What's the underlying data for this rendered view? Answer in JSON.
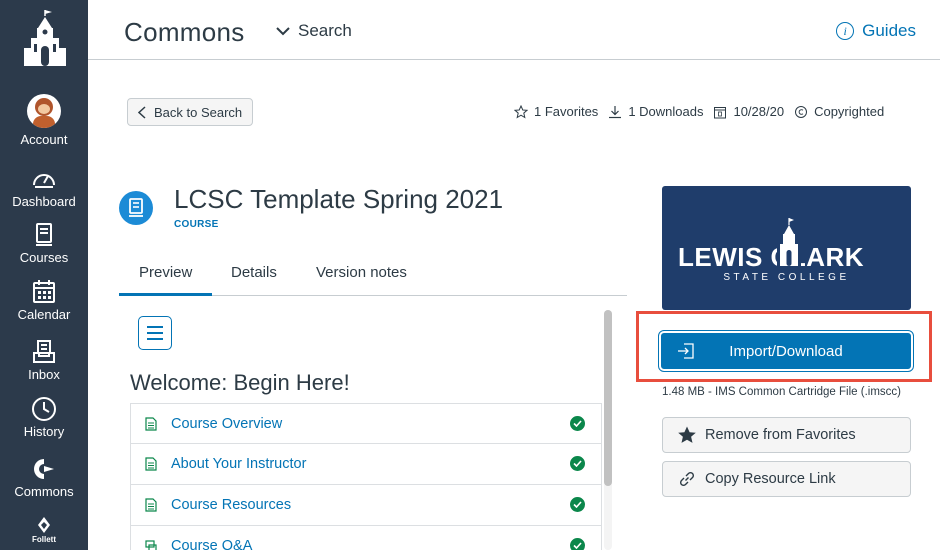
{
  "nav": {
    "account": "Account",
    "dashboard": "Dashboard",
    "courses": "Courses",
    "calendar": "Calendar",
    "inbox": "Inbox",
    "history": "History",
    "commons": "Commons",
    "follett": "Follett"
  },
  "header": {
    "title": "Commons",
    "search_label": "Search",
    "guides_label": "Guides"
  },
  "toolbar": {
    "back_label": "Back to Search",
    "favorites": "1 Favorites",
    "downloads": "1 Downloads",
    "date": "10/28/20",
    "license": "Copyrighted"
  },
  "course": {
    "title": "LCSC Template Spring 2021",
    "type": "COURSE"
  },
  "tabs": [
    "Preview",
    "Details",
    "Version notes"
  ],
  "preview": {
    "heading": "Welcome: Begin Here!",
    "items": [
      "Course Overview",
      "About Your Instructor",
      "Course Resources",
      "Course Q&A"
    ]
  },
  "banner": {
    "line1": "LEWIS CLARK",
    "line2": "STATE COLLEGE"
  },
  "actions": {
    "import_label": "Import/Download",
    "file_info": "1.48 MB - IMS Common Cartridge File (.imscc)",
    "favorite_label": "Remove from Favorites",
    "copy_link_label": "Copy Resource Link"
  },
  "colors": {
    "nav_bg": "#2c3a4b",
    "accent": "#0374b5",
    "success": "#0b874b",
    "highlight": "#e84e3d",
    "banner_bg": "#1f3d6b"
  }
}
